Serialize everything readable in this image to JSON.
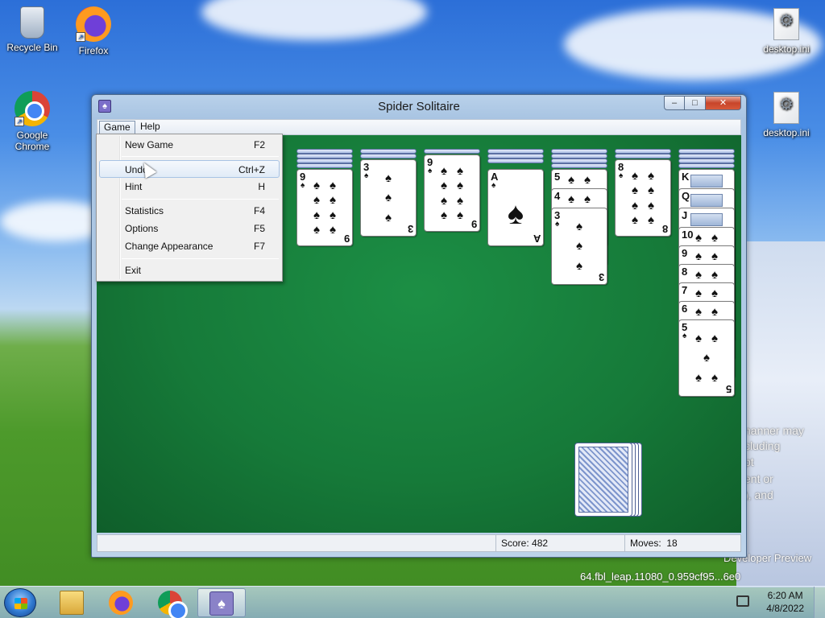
{
  "desktop": {
    "icons": {
      "recycle_bin": "Recycle Bin",
      "firefox": "Firefox",
      "chrome_line1": "Google",
      "chrome_line2": "Chrome",
      "ini1": "desktop.ini",
      "ini2": "desktop.ini"
    },
    "wallpaper_text": [
      "nanner may",
      "cluding",
      "pt",
      "ent or",
      "), and"
    ],
    "wallpaper_footer1": "Developer Preview",
    "wallpaper_footer2": "64.fbl_leap.11080_0.959cf95...6e0"
  },
  "window": {
    "title": "Spider Solitaire",
    "icon": "spider-solitaire-icon",
    "caption": {
      "minimize": "–",
      "maximize": "□",
      "close": "✕"
    }
  },
  "menubar": {
    "game": "Game",
    "help": "Help"
  },
  "game_menu": {
    "items": [
      {
        "label": "New Game",
        "key": "F2"
      },
      {
        "label": "Undo",
        "key": "Ctrl+Z"
      },
      {
        "label": "Hint",
        "key": "H"
      },
      {
        "label": "Statistics",
        "key": "F4"
      },
      {
        "label": "Options",
        "key": "F5"
      },
      {
        "label": "Change Appearance",
        "key": "F7"
      },
      {
        "label": "Exit",
        "key": ""
      }
    ],
    "hovered": "Undo"
  },
  "tableau": {
    "col2": {
      "rank": "9",
      "suit": "♠"
    },
    "col3": {
      "rank": "3",
      "suit": "♠"
    },
    "col4": {
      "rank": "9",
      "suit": "♠"
    },
    "col5": {
      "rank": "A",
      "suit": "♠"
    },
    "col6": {
      "partial": [
        "5",
        "4"
      ],
      "rank": "3",
      "suit": "♠"
    },
    "col7": {
      "rank": "8",
      "suit": "♠"
    },
    "col8": {
      "partial": [
        "K",
        "Q",
        "J",
        "10",
        "9",
        "8",
        "7",
        "6"
      ],
      "rank": "5",
      "suit": "♠"
    }
  },
  "status": {
    "score_label": "Score:",
    "score": "482",
    "moves_label": "Moves:",
    "moves": "18"
  },
  "taskbar": {
    "time": "6:20 AM",
    "date": "4/8/2022"
  },
  "colors": {
    "felt": "#167a39",
    "card_back": "#8ea4d8",
    "titlebar": "#b9d1ea"
  }
}
